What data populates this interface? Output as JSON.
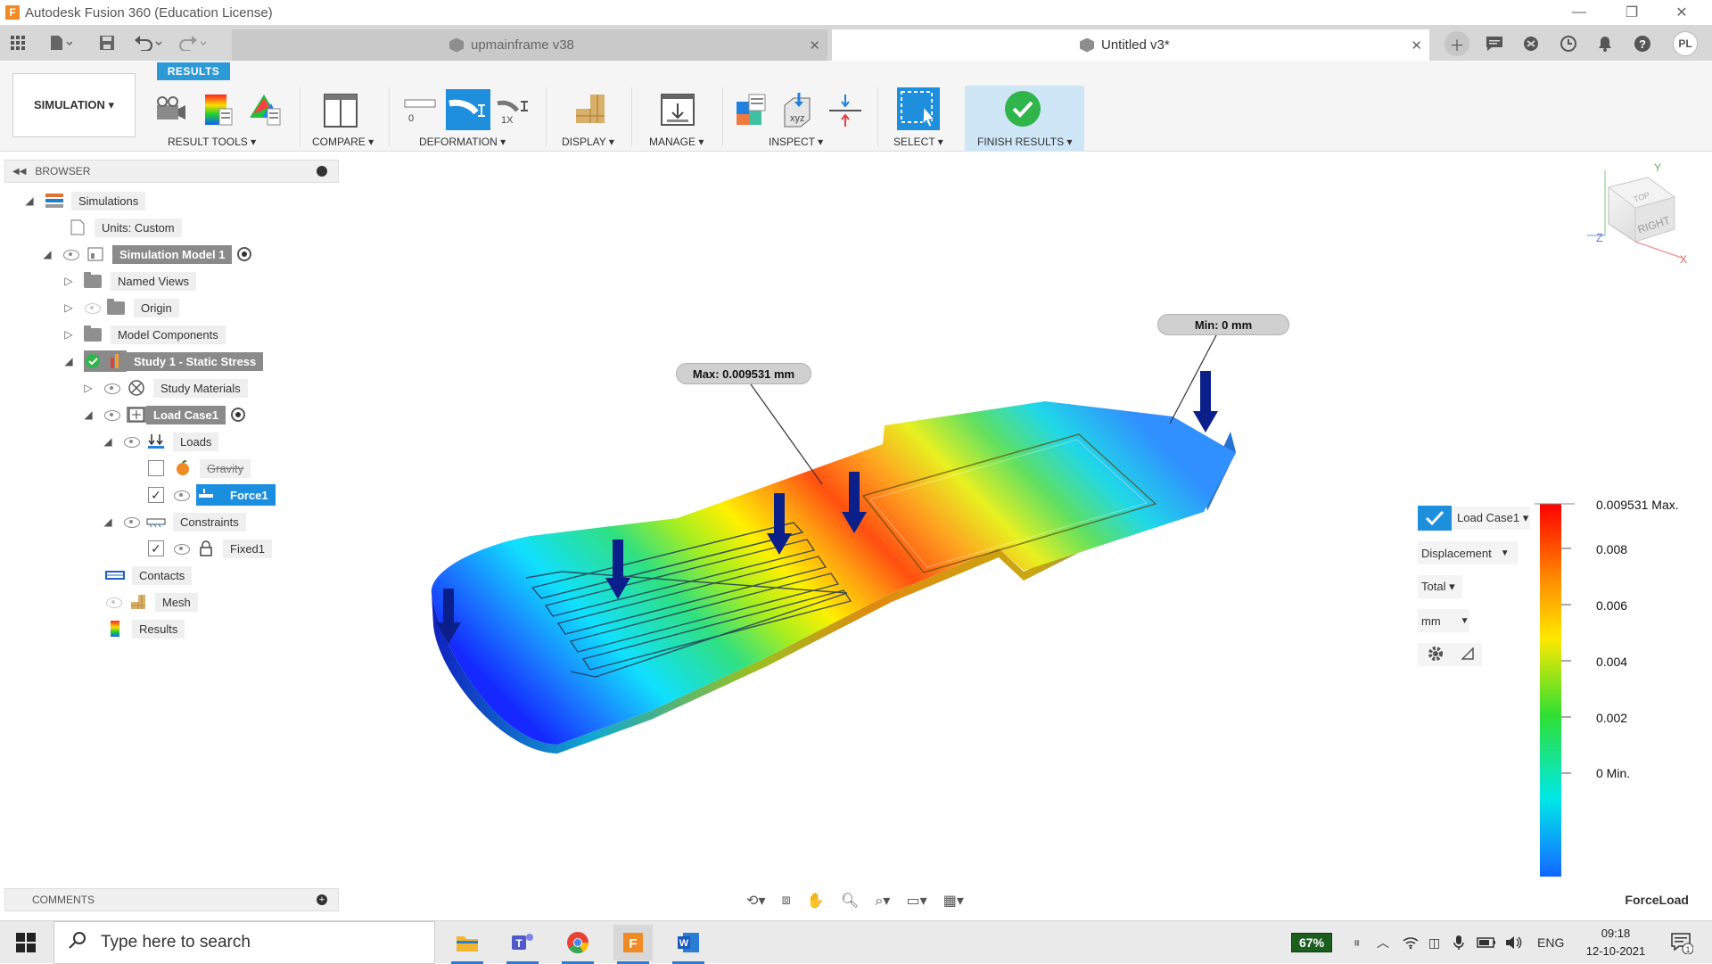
{
  "window": {
    "title": "Autodesk Fusion 360 (Education License)",
    "minimize": "—",
    "restore": "❐",
    "close": "✕"
  },
  "tabs": [
    {
      "label": "upmainframe v38",
      "close": "✕"
    },
    {
      "label": "Untitled v3*",
      "close": "✕"
    }
  ],
  "toolbar_right": {
    "user_initials": "PL"
  },
  "ribbon": {
    "workspace": "SIMULATION ▾",
    "active_tab": "RESULTS",
    "groups": [
      {
        "label": "RESULT TOOLS ▾"
      },
      {
        "label": "COMPARE ▾"
      },
      {
        "label": "DEFORMATION ▾"
      },
      {
        "label": "DISPLAY ▾"
      },
      {
        "label": "MANAGE ▾"
      },
      {
        "label": "INSPECT ▾"
      },
      {
        "label": "SELECT ▾"
      },
      {
        "label": "FINISH RESULTS ▾"
      }
    ],
    "deformation_labels": {
      "zero": "0",
      "one_x": "1X"
    }
  },
  "browser": {
    "title": "BROWSER",
    "items": [
      {
        "label": "Simulations"
      },
      {
        "label": "Units: Custom"
      },
      {
        "label": "Simulation Model 1"
      },
      {
        "label": "Named Views"
      },
      {
        "label": "Origin"
      },
      {
        "label": "Model Components"
      },
      {
        "label": "Study 1 - Static Stress"
      },
      {
        "label": "Study Materials"
      },
      {
        "label": "Load Case1"
      },
      {
        "label": "Loads"
      },
      {
        "label": "Gravity"
      },
      {
        "label": "Force1"
      },
      {
        "label": "Constraints"
      },
      {
        "label": "Fixed1"
      },
      {
        "label": "Contacts"
      },
      {
        "label": "Mesh"
      },
      {
        "label": "Results"
      }
    ]
  },
  "viewport": {
    "max_callout": "Max: 0.009531 mm",
    "min_callout": "Min: 0 mm",
    "viewcube_face": "RIGHT",
    "viewcube_top": "TOP",
    "axis_x": "X",
    "axis_y": "Y",
    "axis_z": "Z"
  },
  "legend": {
    "load_case": "Load Case1 ▾",
    "result_type": "Displacement",
    "component": "Total ▾",
    "units": "mm",
    "ticks": [
      "0.009531 Max.",
      "0.008",
      "0.006",
      "0.004",
      "0.002",
      "0 Min."
    ]
  },
  "comments": {
    "title": "COMMENTS"
  },
  "status": {
    "right_label": "ForceLoad"
  },
  "taskbar": {
    "search_placeholder": "Type here to search",
    "battery": "67%",
    "language": "ENG",
    "time": "09:18",
    "date": "12-10-2021",
    "notification_count": "1"
  },
  "colors": {
    "accent": "#2d9ad8",
    "selected_blue": "#1a8fe0",
    "finish_green": "#2fb54a",
    "force_arrow": "#0a1f8a"
  }
}
